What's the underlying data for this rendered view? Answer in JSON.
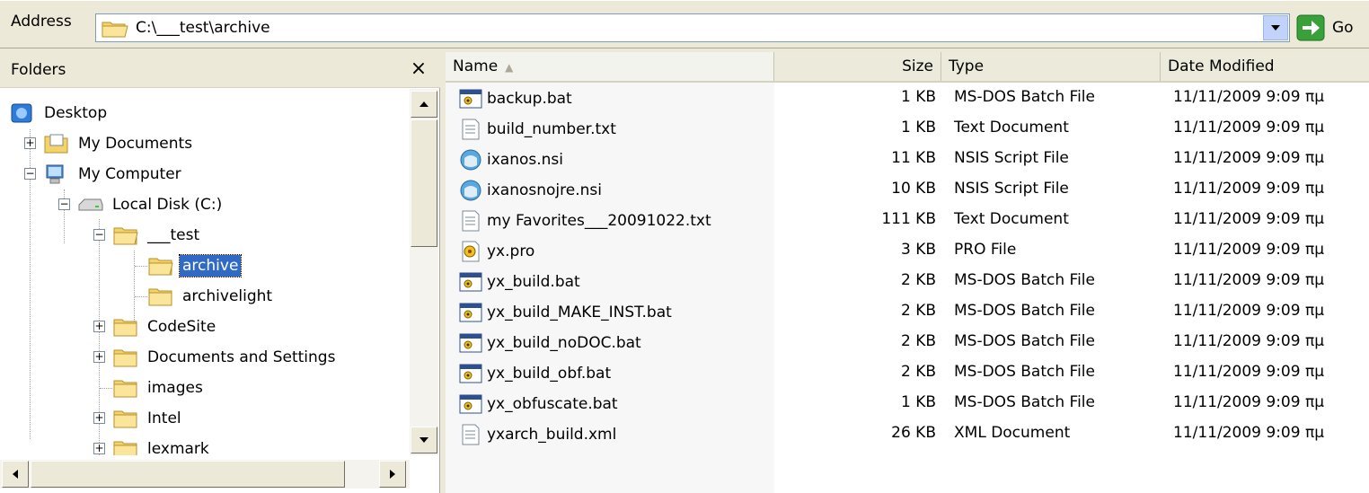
{
  "address": {
    "label": "Address",
    "path": "C:\\___test\\archive",
    "go_label": "Go"
  },
  "folders": {
    "title": "Folders",
    "close_glyph": "×",
    "tree": [
      {
        "label": "Desktop",
        "icon": "desktop-icon"
      },
      {
        "label": "My Documents",
        "icon": "my-documents-icon"
      },
      {
        "label": "My Computer",
        "icon": "my-computer-icon"
      },
      {
        "label": "Local Disk (C:)",
        "icon": "disk-drive-icon"
      },
      {
        "label": "___test",
        "icon": "folder-open-icon"
      },
      {
        "label": "archive",
        "icon": "folder-open-icon",
        "selected": true
      },
      {
        "label": "archivelight",
        "icon": "folder-icon"
      },
      {
        "label": "CodeSite",
        "icon": "folder-icon"
      },
      {
        "label": "Documents and Settings",
        "icon": "folder-icon"
      },
      {
        "label": "images",
        "icon": "folder-icon"
      },
      {
        "label": "Intel",
        "icon": "folder-icon"
      },
      {
        "label": "lexmark",
        "icon": "folder-icon"
      }
    ]
  },
  "columns": {
    "name": "Name",
    "size": "Size",
    "type": "Type",
    "date": "Date Modified"
  },
  "files": [
    {
      "name": "backup.bat",
      "size": "1 KB",
      "type": "MS-DOS Batch File",
      "date": "11/11/2009 9:09 πμ",
      "icon": "batch-file-icon"
    },
    {
      "name": "build_number.txt",
      "size": "1 KB",
      "type": "Text Document",
      "date": "11/11/2009 9:09 πμ",
      "icon": "text-file-icon"
    },
    {
      "name": "ixanos.nsi",
      "size": "11 KB",
      "type": "NSIS Script File",
      "date": "11/11/2009 9:09 πμ",
      "icon": "nsis-file-icon"
    },
    {
      "name": "ixanosnojre.nsi",
      "size": "10 KB",
      "type": "NSIS Script File",
      "date": "11/11/2009 9:09 πμ",
      "icon": "nsis-file-icon"
    },
    {
      "name": "my Favorites___20091022.txt",
      "size": "111 KB",
      "type": "Text Document",
      "date": "11/11/2009 9:09 πμ",
      "icon": "text-file-icon"
    },
    {
      "name": "yx.pro",
      "size": "3 KB",
      "type": "PRO File",
      "date": "11/11/2009 9:09 πμ",
      "icon": "pro-file-icon"
    },
    {
      "name": "yx_build.bat",
      "size": "2 KB",
      "type": "MS-DOS Batch File",
      "date": "11/11/2009 9:09 πμ",
      "icon": "batch-file-icon"
    },
    {
      "name": "yx_build_MAKE_INST.bat",
      "size": "2 KB",
      "type": "MS-DOS Batch File",
      "date": "11/11/2009 9:09 πμ",
      "icon": "batch-file-icon"
    },
    {
      "name": "yx_build_noDOC.bat",
      "size": "2 KB",
      "type": "MS-DOS Batch File",
      "date": "11/11/2009 9:09 πμ",
      "icon": "batch-file-icon"
    },
    {
      "name": "yx_build_obf.bat",
      "size": "2 KB",
      "type": "MS-DOS Batch File",
      "date": "11/11/2009 9:09 πμ",
      "icon": "batch-file-icon"
    },
    {
      "name": "yx_obfuscate.bat",
      "size": "1 KB",
      "type": "MS-DOS Batch File",
      "date": "11/11/2009 9:09 πμ",
      "icon": "batch-file-icon"
    },
    {
      "name": "yxarch_build.xml",
      "size": "26 KB",
      "type": "XML Document",
      "date": "11/11/2009 9:09 πμ",
      "icon": "xml-file-icon"
    }
  ]
}
